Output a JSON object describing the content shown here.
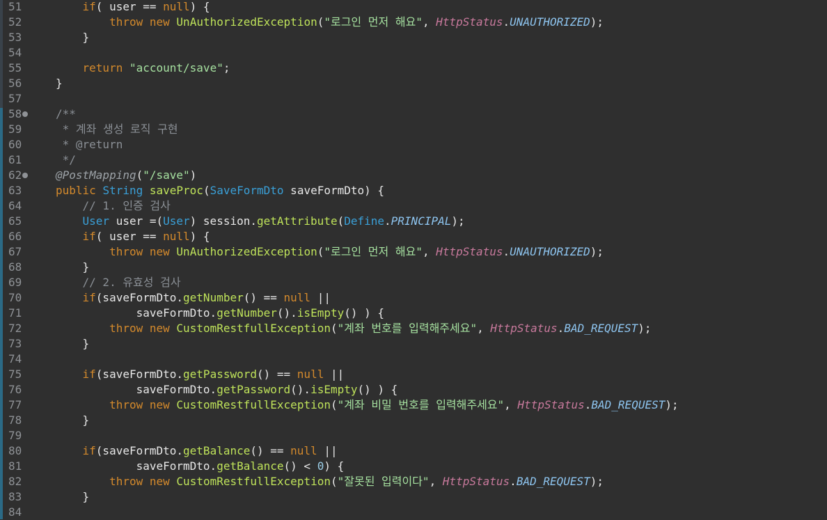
{
  "editor": {
    "lines": [
      {
        "n": "51",
        "fold": false,
        "tokens": [
          [
            "    ",
            ""
          ],
          [
            "if",
            "kw"
          ],
          [
            "( user == ",
            ""
          ],
          [
            "null",
            "kw"
          ],
          [
            ") {",
            ""
          ]
        ]
      },
      {
        "n": "52",
        "fold": false,
        "tokens": [
          [
            "        ",
            ""
          ],
          [
            "throw",
            "kw"
          ],
          [
            " ",
            ""
          ],
          [
            "new",
            "kw"
          ],
          [
            " ",
            ""
          ],
          [
            "UnAuthorizedException",
            "mth"
          ],
          [
            "(",
            ""
          ],
          [
            "\"로그인 먼저 해요\"",
            "str"
          ],
          [
            ", ",
            ""
          ],
          [
            "HttpStatus",
            "ital"
          ],
          [
            ".",
            ""
          ],
          [
            "UNAUTHORIZED",
            "const"
          ],
          [
            ");",
            ""
          ]
        ]
      },
      {
        "n": "53",
        "fold": false,
        "tokens": [
          [
            "    }",
            ""
          ]
        ]
      },
      {
        "n": "54",
        "fold": false,
        "tokens": []
      },
      {
        "n": "55",
        "fold": false,
        "tokens": [
          [
            "    ",
            ""
          ],
          [
            "return",
            "kw"
          ],
          [
            " ",
            ""
          ],
          [
            "\"account/save\"",
            "str"
          ],
          [
            ";",
            ""
          ]
        ]
      },
      {
        "n": "56",
        "fold": false,
        "tokens": [
          [
            "}",
            ""
          ]
        ]
      },
      {
        "n": "57",
        "fold": false,
        "tokens": []
      },
      {
        "n": "58",
        "fold": true,
        "tokens": [
          [
            "/**",
            "cm"
          ]
        ]
      },
      {
        "n": "59",
        "fold": false,
        "tokens": [
          [
            " * 계좌 생성 로직 구현",
            "cm"
          ]
        ]
      },
      {
        "n": "60",
        "fold": false,
        "tokens": [
          [
            " * @return",
            "cm"
          ]
        ]
      },
      {
        "n": "61",
        "fold": false,
        "tokens": [
          [
            " */",
            "cm"
          ]
        ]
      },
      {
        "n": "62",
        "fold": true,
        "tokens": [
          [
            "@PostMapping",
            "ann"
          ],
          [
            "(",
            ""
          ],
          [
            "\"/save\"",
            "str"
          ],
          [
            ")",
            ""
          ]
        ]
      },
      {
        "n": "63",
        "fold": false,
        "tokens": [
          [
            "public",
            "kw"
          ],
          [
            " ",
            ""
          ],
          [
            "String",
            "cls"
          ],
          [
            " ",
            ""
          ],
          [
            "saveProc",
            "mth"
          ],
          [
            "(",
            ""
          ],
          [
            "SaveFormDto",
            "cls"
          ],
          [
            " saveFormDto) {",
            ""
          ]
        ]
      },
      {
        "n": "64",
        "fold": false,
        "tokens": [
          [
            "    ",
            ""
          ],
          [
            "// 1. 인증 검사",
            "cm"
          ]
        ]
      },
      {
        "n": "65",
        "fold": false,
        "tokens": [
          [
            "    ",
            ""
          ],
          [
            "User",
            "cls"
          ],
          [
            " user =(",
            ""
          ],
          [
            "User",
            "cls"
          ],
          [
            ") session.",
            ""
          ],
          [
            "getAttribute",
            "mth"
          ],
          [
            "(",
            ""
          ],
          [
            "Define",
            "cls"
          ],
          [
            ".",
            ""
          ],
          [
            "PRINCIPAL",
            "const"
          ],
          [
            ");",
            ""
          ]
        ]
      },
      {
        "n": "66",
        "fold": false,
        "tokens": [
          [
            "    ",
            ""
          ],
          [
            "if",
            "kw"
          ],
          [
            "( user == ",
            ""
          ],
          [
            "null",
            "kw"
          ],
          [
            ") {",
            ""
          ]
        ]
      },
      {
        "n": "67",
        "fold": false,
        "tokens": [
          [
            "        ",
            ""
          ],
          [
            "throw",
            "kw"
          ],
          [
            " ",
            ""
          ],
          [
            "new",
            "kw"
          ],
          [
            " ",
            ""
          ],
          [
            "UnAuthorizedException",
            "mth"
          ],
          [
            "(",
            ""
          ],
          [
            "\"로그인 먼저 해요\"",
            "str"
          ],
          [
            ", ",
            ""
          ],
          [
            "HttpStatus",
            "ital"
          ],
          [
            ".",
            ""
          ],
          [
            "UNAUTHORIZED",
            "const"
          ],
          [
            ");",
            ""
          ]
        ]
      },
      {
        "n": "68",
        "fold": false,
        "tokens": [
          [
            "    }",
            ""
          ]
        ]
      },
      {
        "n": "69",
        "fold": false,
        "tokens": [
          [
            "    ",
            ""
          ],
          [
            "// 2. 유효성 검사",
            "cm"
          ]
        ]
      },
      {
        "n": "70",
        "fold": false,
        "tokens": [
          [
            "    ",
            ""
          ],
          [
            "if",
            "kw"
          ],
          [
            "(saveFormDto.",
            ""
          ],
          [
            "getNumber",
            "mth"
          ],
          [
            "() == ",
            ""
          ],
          [
            "null",
            "kw"
          ],
          [
            " ||",
            ""
          ]
        ]
      },
      {
        "n": "71",
        "fold": false,
        "tokens": [
          [
            "            saveFormDto.",
            ""
          ],
          [
            "getNumber",
            "mth"
          ],
          [
            "().",
            ""
          ],
          [
            "isEmpty",
            "mth"
          ],
          [
            "() ) {",
            ""
          ]
        ]
      },
      {
        "n": "72",
        "fold": false,
        "tokens": [
          [
            "        ",
            ""
          ],
          [
            "throw",
            "kw"
          ],
          [
            " ",
            ""
          ],
          [
            "new",
            "kw"
          ],
          [
            " ",
            ""
          ],
          [
            "CustomRestfullException",
            "mth"
          ],
          [
            "(",
            ""
          ],
          [
            "\"계좌 번호를 입력해주세요\"",
            "str"
          ],
          [
            ", ",
            ""
          ],
          [
            "HttpStatus",
            "ital"
          ],
          [
            ".",
            ""
          ],
          [
            "BAD_REQUEST",
            "const"
          ],
          [
            ");",
            ""
          ]
        ]
      },
      {
        "n": "73",
        "fold": false,
        "tokens": [
          [
            "    }",
            ""
          ]
        ]
      },
      {
        "n": "74",
        "fold": false,
        "tokens": []
      },
      {
        "n": "75",
        "fold": false,
        "tokens": [
          [
            "    ",
            ""
          ],
          [
            "if",
            "kw"
          ],
          [
            "(saveFormDto.",
            ""
          ],
          [
            "getPassword",
            "mth"
          ],
          [
            "() == ",
            ""
          ],
          [
            "null",
            "kw"
          ],
          [
            " ||",
            ""
          ]
        ]
      },
      {
        "n": "76",
        "fold": false,
        "tokens": [
          [
            "            saveFormDto.",
            ""
          ],
          [
            "getPassword",
            "mth"
          ],
          [
            "().",
            ""
          ],
          [
            "isEmpty",
            "mth"
          ],
          [
            "() ) {",
            ""
          ]
        ]
      },
      {
        "n": "77",
        "fold": false,
        "tokens": [
          [
            "        ",
            ""
          ],
          [
            "throw",
            "kw"
          ],
          [
            " ",
            ""
          ],
          [
            "new",
            "kw"
          ],
          [
            " ",
            ""
          ],
          [
            "CustomRestfullException",
            "mth"
          ],
          [
            "(",
            ""
          ],
          [
            "\"계좌 비밀 번호를 입력해주세요\"",
            "str"
          ],
          [
            ", ",
            ""
          ],
          [
            "HttpStatus",
            "ital"
          ],
          [
            ".",
            ""
          ],
          [
            "BAD_REQUEST",
            "const"
          ],
          [
            ");",
            ""
          ]
        ]
      },
      {
        "n": "78",
        "fold": false,
        "tokens": [
          [
            "    }",
            ""
          ]
        ]
      },
      {
        "n": "79",
        "fold": false,
        "tokens": []
      },
      {
        "n": "80",
        "fold": false,
        "tokens": [
          [
            "    ",
            ""
          ],
          [
            "if",
            "kw"
          ],
          [
            "(saveFormDto.",
            ""
          ],
          [
            "getBalance",
            "mth"
          ],
          [
            "() == ",
            ""
          ],
          [
            "null",
            "kw"
          ],
          [
            " ||",
            ""
          ]
        ]
      },
      {
        "n": "81",
        "fold": false,
        "tokens": [
          [
            "            saveFormDto.",
            ""
          ],
          [
            "getBalance",
            "mth"
          ],
          [
            "() < ",
            ""
          ],
          [
            "0",
            "num"
          ],
          [
            ") {",
            ""
          ]
        ]
      },
      {
        "n": "82",
        "fold": false,
        "tokens": [
          [
            "        ",
            ""
          ],
          [
            "throw",
            "kw"
          ],
          [
            " ",
            ""
          ],
          [
            "new",
            "kw"
          ],
          [
            " ",
            ""
          ],
          [
            "CustomRestfullException",
            "mth"
          ],
          [
            "(",
            ""
          ],
          [
            "\"잘못된 입력이다\"",
            "str"
          ],
          [
            ", ",
            ""
          ],
          [
            "HttpStatus",
            "ital"
          ],
          [
            ".",
            ""
          ],
          [
            "BAD_REQUEST",
            "const"
          ],
          [
            ");",
            ""
          ]
        ]
      },
      {
        "n": "83",
        "fold": false,
        "tokens": [
          [
            "    }",
            ""
          ]
        ]
      },
      {
        "n": "84",
        "fold": false,
        "tokens": []
      }
    ]
  }
}
